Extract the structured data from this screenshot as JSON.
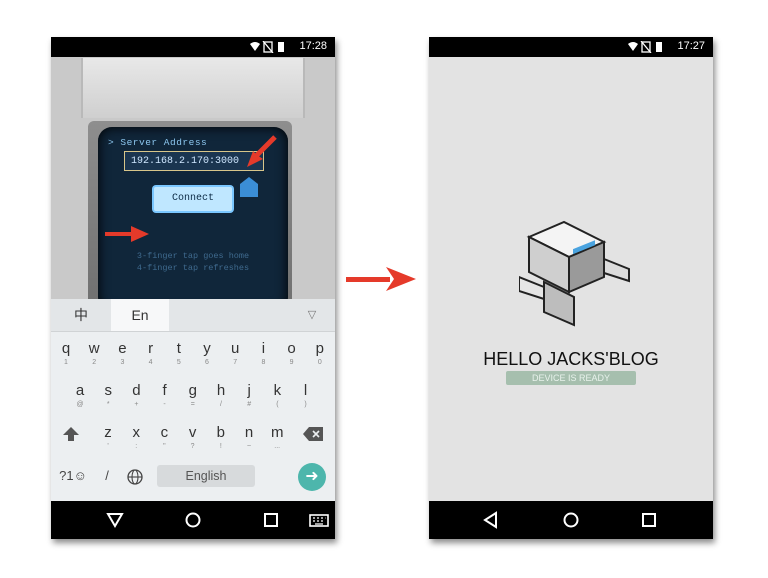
{
  "left_phone": {
    "status_time": "17:28",
    "server_label": "> Server Address",
    "server_value": "192.168.2.170:3000",
    "connect_label": "Connect",
    "tip_line1": "3-finger tap goes home",
    "tip_line2": "4-finger tap refreshes",
    "keyboard": {
      "tab_zh": "中",
      "tab_en": "En",
      "row1": [
        {
          "main": "q",
          "sub": "1"
        },
        {
          "main": "w",
          "sub": "2"
        },
        {
          "main": "e",
          "sub": "3"
        },
        {
          "main": "r",
          "sub": "4"
        },
        {
          "main": "t",
          "sub": "5"
        },
        {
          "main": "y",
          "sub": "6"
        },
        {
          "main": "u",
          "sub": "7"
        },
        {
          "main": "i",
          "sub": "8"
        },
        {
          "main": "o",
          "sub": "9"
        },
        {
          "main": "p",
          "sub": "0"
        }
      ],
      "row2": [
        {
          "main": "a",
          "sub": "@"
        },
        {
          "main": "s",
          "sub": "*"
        },
        {
          "main": "d",
          "sub": "+"
        },
        {
          "main": "f",
          "sub": "-"
        },
        {
          "main": "g",
          "sub": "="
        },
        {
          "main": "h",
          "sub": "/"
        },
        {
          "main": "j",
          "sub": "#"
        },
        {
          "main": "k",
          "sub": "("
        },
        {
          "main": "l",
          "sub": ")"
        }
      ],
      "row3": [
        {
          "main": "z",
          "sub": "'"
        },
        {
          "main": "x",
          "sub": ":"
        },
        {
          "main": "c",
          "sub": "\""
        },
        {
          "main": "v",
          "sub": "?"
        },
        {
          "main": "b",
          "sub": "!"
        },
        {
          "main": "n",
          "sub": "~"
        },
        {
          "main": "m",
          "sub": "..."
        }
      ],
      "symbols_label": "?1☺",
      "slash_label": "/",
      "space_label": "English"
    }
  },
  "right_phone": {
    "status_time": "17:27",
    "hello_text": "HELLO JACKS'BLOG",
    "ready_text": "DEVICE IS READY"
  },
  "colors": {
    "accent_red": "#e53a2a",
    "enter_teal": "#4db6ac",
    "ready_green": "#a6bfae"
  }
}
